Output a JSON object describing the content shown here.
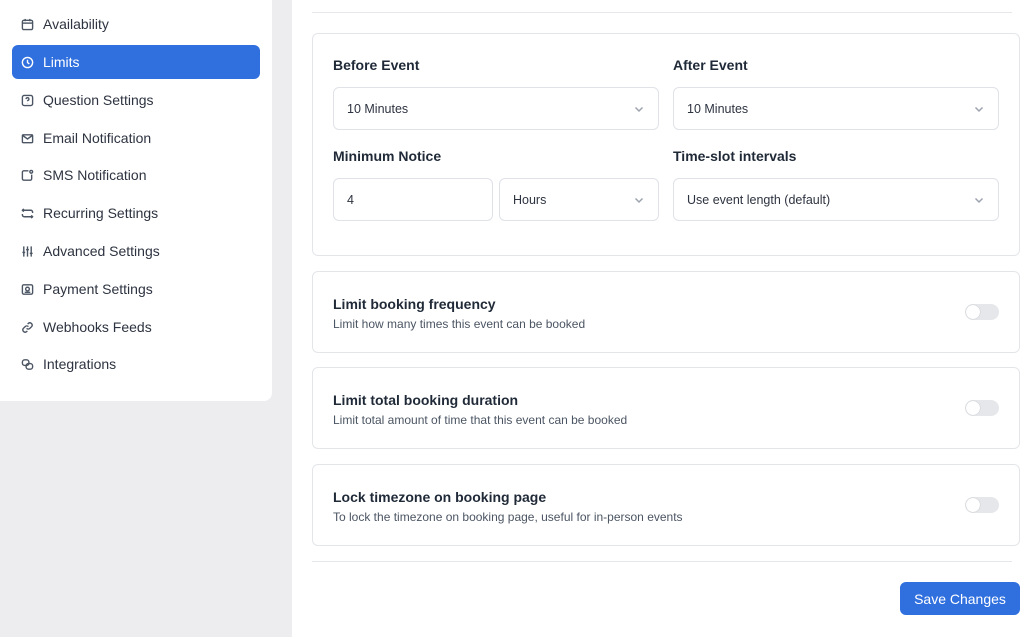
{
  "sidebar": {
    "items": [
      {
        "label": "Availability",
        "icon": "calendar-icon"
      },
      {
        "label": "Limits",
        "icon": "clock-icon",
        "active": true
      },
      {
        "label": "Question Settings",
        "icon": "question-icon"
      },
      {
        "label": "Email Notification",
        "icon": "mail-icon"
      },
      {
        "label": "SMS Notification",
        "icon": "sms-icon"
      },
      {
        "label": "Recurring Settings",
        "icon": "repeat-icon"
      },
      {
        "label": "Advanced Settings",
        "icon": "sliders-icon"
      },
      {
        "label": "Payment Settings",
        "icon": "payment-icon"
      },
      {
        "label": "Webhooks Feeds",
        "icon": "link-icon"
      },
      {
        "label": "Integrations",
        "icon": "integrations-icon"
      }
    ]
  },
  "limits": {
    "before_event": {
      "label": "Before Event",
      "value": "10 Minutes"
    },
    "after_event": {
      "label": "After Event",
      "value": "10 Minutes"
    },
    "minimum_notice": {
      "label": "Minimum Notice",
      "value": "4",
      "unit": "Hours"
    },
    "time_slot": {
      "label": "Time-slot intervals",
      "value": "Use event length (default)"
    }
  },
  "toggles": [
    {
      "title": "Limit booking frequency",
      "description": "Limit how many times this event can be booked",
      "enabled": false
    },
    {
      "title": "Limit total booking duration",
      "description": "Limit total amount of time that this event can be booked",
      "enabled": false
    },
    {
      "title": "Lock timezone on booking page",
      "description": "To lock the timezone on booking page, useful for in-person events",
      "enabled": false
    }
  ],
  "actions": {
    "save_label": "Save Changes"
  },
  "colors": {
    "accent": "#2f6fde",
    "toggle_off": "#e5e7eb"
  }
}
